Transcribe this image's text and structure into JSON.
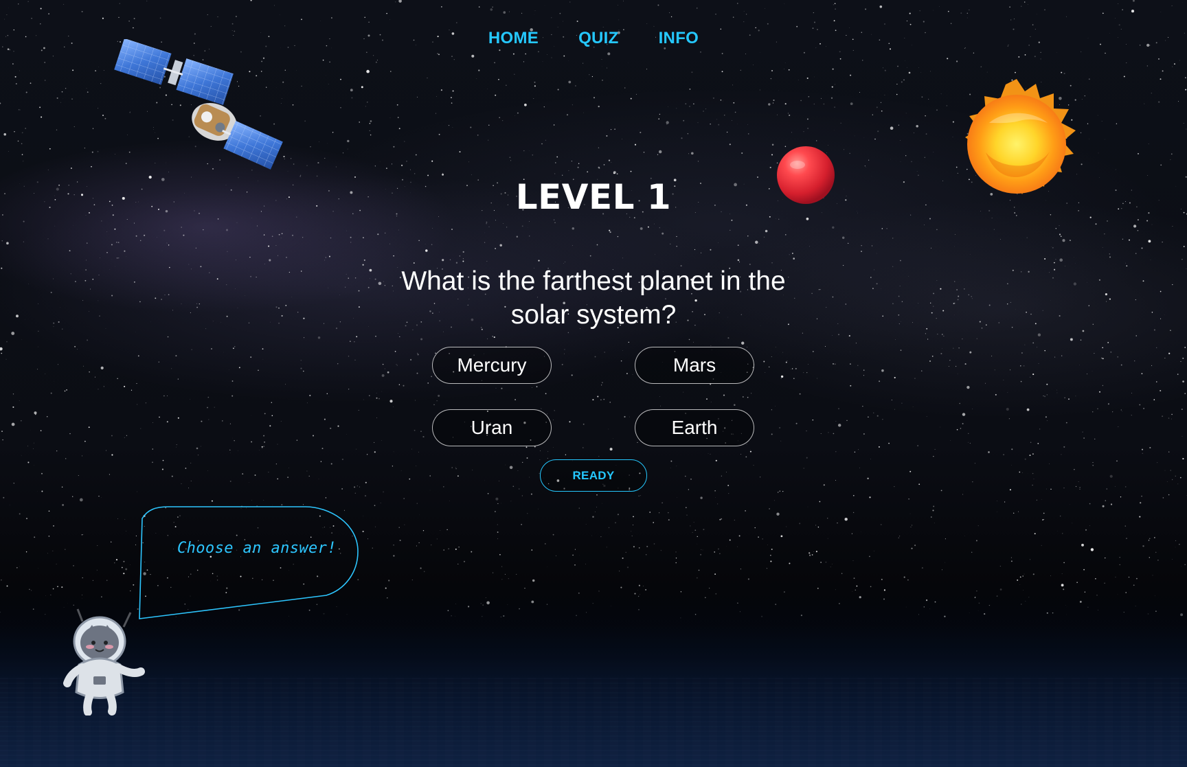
{
  "nav": {
    "items": [
      {
        "label": "HOME"
      },
      {
        "label": "QUIZ"
      },
      {
        "label": "INFO"
      }
    ]
  },
  "quiz": {
    "level_title": "LEVEL 1",
    "question": "What is the farthest planet in the solar system?",
    "answers": [
      {
        "label": "Mercury"
      },
      {
        "label": "Mars"
      },
      {
        "label": "Uran"
      },
      {
        "label": "Earth"
      }
    ],
    "ready_label": "READY"
  },
  "mascot": {
    "speech": "Choose an answer!"
  },
  "colors": {
    "accent": "#25c8ff",
    "text": "#ffffff",
    "background": "#0b0d14",
    "ocean": "#0f203e",
    "planet_red": "#e8323a",
    "sun_orange": "#ff9a1a"
  },
  "icons": {
    "satellite": "satellite-icon",
    "planet": "planet-icon",
    "sun": "sun-icon",
    "mascot": "astronaut-cat-icon"
  }
}
